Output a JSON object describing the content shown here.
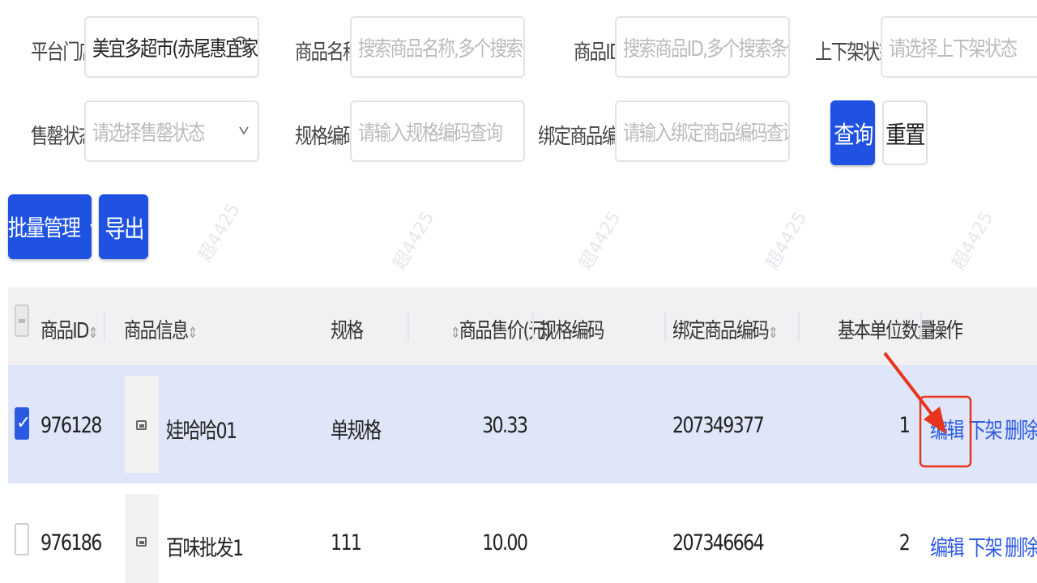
{
  "filters": {
    "store": {
      "label": "平台门店",
      "value": "美宜多超市(赤尾惠宜家)",
      "icon": "search-icon"
    },
    "product_name": {
      "label": "商品名称",
      "placeholder": "搜索商品名称,多个搜索条..."
    },
    "product_id": {
      "label": "商品ID",
      "placeholder": "搜索商品ID,多个搜索条件..."
    },
    "shelf_status": {
      "label": "上下架状态",
      "placeholder": "请选择上下架状态"
    },
    "sold_out_status": {
      "label": "售罄状态",
      "placeholder": "请选择售罄状态",
      "icon": "chevron-down-icon"
    },
    "spec_code": {
      "label": "规格编码",
      "placeholder": "请输入规格编码查询"
    },
    "bound_code": {
      "label": "绑定商品编码",
      "placeholder": "请输入绑定商品编码查询"
    },
    "query_label": "查询",
    "reset_label": "重置"
  },
  "toolbar": {
    "batch_label": "批量管理",
    "batch_icon": "chevron-down-icon",
    "export_label": "导出"
  },
  "table": {
    "headers": {
      "id": "商品ID",
      "info": "商品信息",
      "spec": "规格",
      "price": "商品售价(元)",
      "spec_code": "规格编码",
      "bound_code": "绑定商品编码",
      "unit_qty": "基本单位数量",
      "actions": "操作"
    },
    "rows": [
      {
        "selected": true,
        "id": "976128",
        "name": "娃哈哈01",
        "spec": "单规格",
        "price": "30.33",
        "bound_code": "207349377",
        "unit_qty": "1"
      },
      {
        "selected": false,
        "id": "976186",
        "name": "百味批发1",
        "spec": "111",
        "price": "10.00",
        "bound_code": "207346664",
        "unit_qty": "2"
      }
    ],
    "actions": {
      "edit": "编辑",
      "off_shelf": "下架",
      "delete": "删除"
    }
  },
  "watermark": "超4425",
  "colors": {
    "primary": "#1f52e0",
    "selected_row": "#dfe6f9",
    "link": "#2f5be0",
    "annotation": "#e8331f"
  }
}
